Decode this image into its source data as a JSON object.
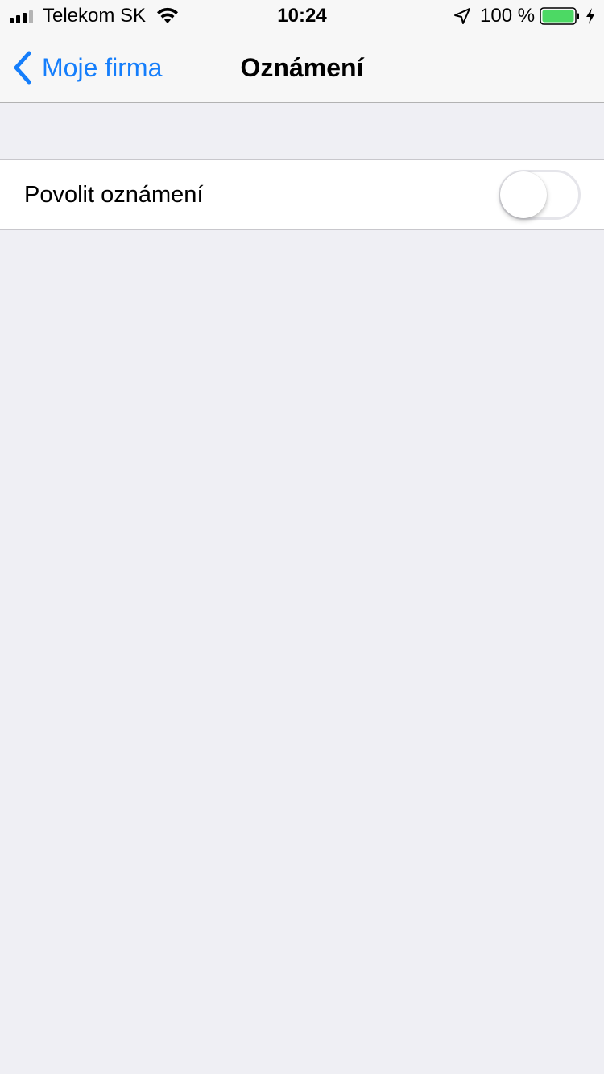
{
  "status_bar": {
    "carrier": "Telekom SK",
    "time": "10:24",
    "battery_percent": "100 %",
    "battery_level": 1.0,
    "battery_color": "#4cd964",
    "icons": [
      "signal-icon",
      "wifi-icon",
      "location-arrow-icon",
      "battery-icon",
      "charging-bolt-icon"
    ]
  },
  "nav": {
    "back_label": "Moje firma",
    "back_icon": "chevron-left-icon",
    "title": "Oznámení",
    "accent_color": "#157efb"
  },
  "settings": {
    "rows": [
      {
        "label": "Povolit oznámení",
        "toggle_on": false
      }
    ]
  }
}
